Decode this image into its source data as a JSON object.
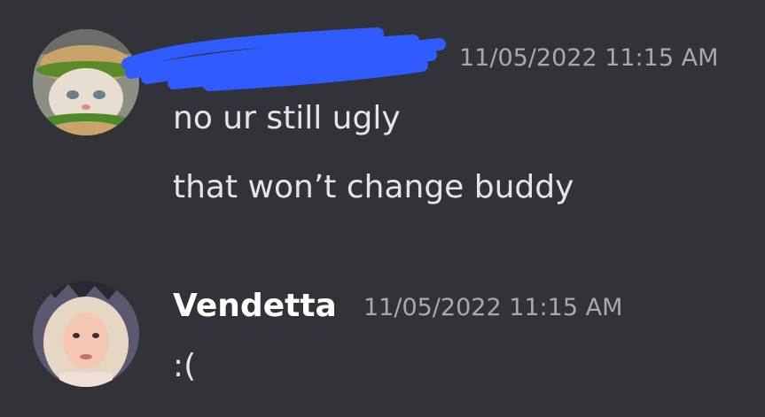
{
  "messages": [
    {
      "author": "",
      "author_redacted": true,
      "timestamp": "11/05/2022 11:15 AM",
      "avatar_icon": "cat-burger-avatar",
      "lines": [
        "no ur still ugly",
        "that won’t change buddy"
      ]
    },
    {
      "author": "Vendetta",
      "author_redacted": false,
      "timestamp": "11/05/2022 11:15 AM",
      "avatar_icon": "user-photo-avatar",
      "lines": [
        ":("
      ]
    }
  ],
  "colors": {
    "background": "#313338",
    "username": "#ffffff",
    "timestamp": "#a7a9b1",
    "text": "#e3e5e8",
    "redaction": "#2f5bff"
  }
}
